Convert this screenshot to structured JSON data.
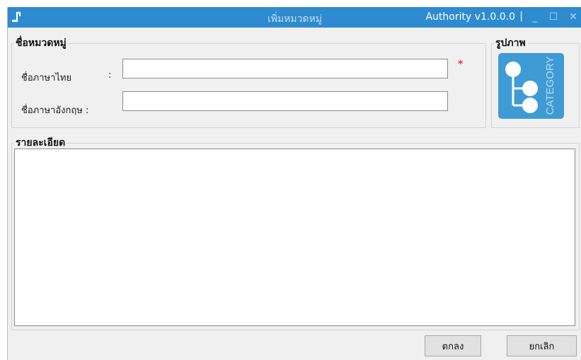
{
  "titlebar": {
    "title": "เพิ่มหมวดหมู่",
    "version": "Authority v1.0.0.0",
    "separator": "|",
    "minimize_glyph": "_",
    "maximize_glyph": "☐",
    "close_glyph": "✕"
  },
  "category_name_group": {
    "legend": "ชื่อหมวดหมู่",
    "thai_label": "ชื่อภาษาไทย",
    "thai_colon": ":",
    "thai_value": "",
    "english_label": "ชื่อภาษาอังกฤษ :",
    "english_value": "",
    "required_marker": "*"
  },
  "image_group": {
    "legend": "รูปภาพ",
    "tile_caption": "CATEGORY",
    "tile_icon": "category-tree-icon"
  },
  "detail_group": {
    "legend": "รายละเอียด",
    "value": ""
  },
  "buttons": {
    "ok_label": "ตกลง",
    "cancel_label": "ยกเลิก"
  },
  "colors": {
    "titlebar": "#2e8bd0",
    "tile": "#3f9bd4",
    "required": "#e33b3b",
    "window_bg": "#f0f0f0"
  }
}
